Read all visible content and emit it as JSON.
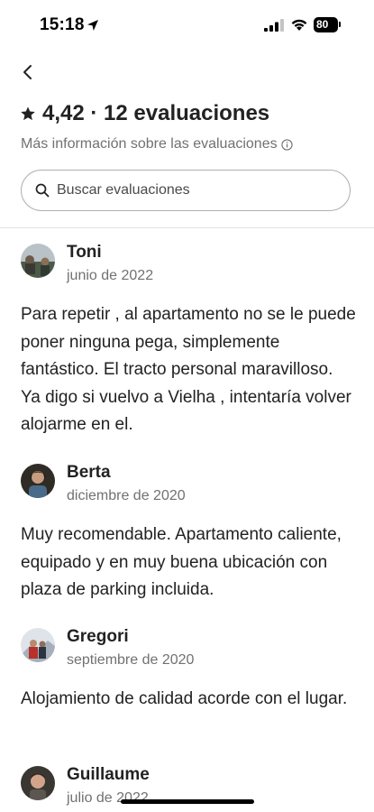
{
  "status_bar": {
    "time": "15:18",
    "battery": "80"
  },
  "header": {
    "rating": "4,42",
    "separator": "·",
    "reviews_count_label": "12 evaluaciones",
    "title": "4,42 · 12 evaluaciones",
    "more_info": "Más información sobre las evaluaciones"
  },
  "search": {
    "placeholder": "Buscar evaluaciones"
  },
  "reviews": [
    {
      "name": "Toni",
      "date": "junio de 2022",
      "text": "Para repetir , al apartamento no se le puede poner ninguna pega, simplemente fantástico. El tracto personal maravilloso. Ya digo si vuelvo a Vielha , intentaría volver alojarme en el."
    },
    {
      "name": "Berta",
      "date": "diciembre de 2020",
      "text": "Muy recomendable. Apartamento caliente, equipado y en muy buena ubicación con plaza de parking incluida."
    },
    {
      "name": "Gregori",
      "date": "septiembre de 2020",
      "text": "Alojamiento de calidad acorde con el lugar."
    },
    {
      "name": "Guillaume",
      "date": "julio de 2022",
      "text": ""
    }
  ]
}
